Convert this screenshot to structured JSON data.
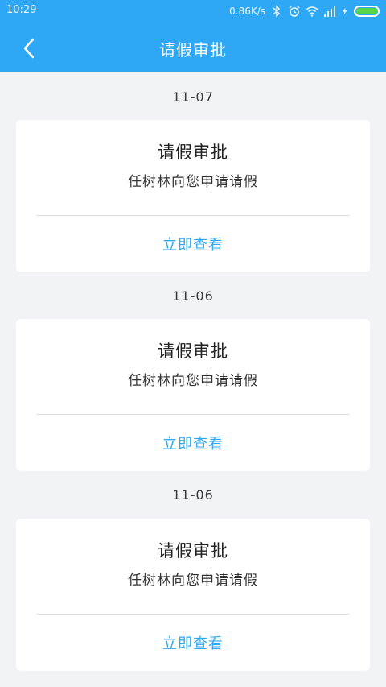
{
  "status_bar": {
    "time": "10:29",
    "network_speed": "0.86K/s",
    "icons": [
      "bluetooth-icon",
      "alarm-icon",
      "wifi-icon",
      "signal-icon",
      "charging-icon",
      "battery-icon"
    ],
    "battery_color": "#58d64a"
  },
  "header": {
    "title": "请假审批",
    "back_icon": "chevron-left-icon",
    "background": "#2ea8f4"
  },
  "items": [
    {
      "date": "11-07",
      "title": "请假审批",
      "message": "任树林向您申请请假",
      "action": "立即查看"
    },
    {
      "date": "11-06",
      "title": "请假审批",
      "message": "任树林向您申请请假",
      "action": "立即查看"
    },
    {
      "date": "11-06",
      "title": "请假审批",
      "message": "任树林向您申请请假",
      "action": "立即查看"
    }
  ],
  "colors": {
    "accent": "#2ea8f4",
    "page_background": "#f2f3f5"
  }
}
